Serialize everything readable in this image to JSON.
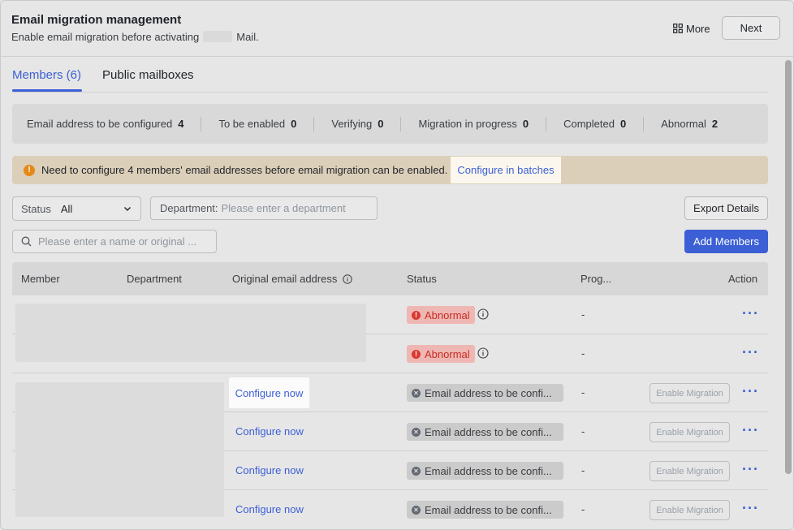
{
  "header": {
    "title": "Email migration management",
    "subtitle_prefix": "Enable email migration before activating",
    "subtitle_suffix": "Mail.",
    "more_label": "More",
    "next_label": "Next"
  },
  "tabs": [
    {
      "label": "Members (6)",
      "active": true
    },
    {
      "label": "Public mailboxes",
      "active": false
    }
  ],
  "stats": [
    {
      "label": "Email address to be configured",
      "value": "4"
    },
    {
      "label": "To be enabled",
      "value": "0"
    },
    {
      "label": "Verifying",
      "value": "0"
    },
    {
      "label": "Migration in progress",
      "value": "0"
    },
    {
      "label": "Completed",
      "value": "0"
    },
    {
      "label": "Abnormal",
      "value": "2"
    }
  ],
  "alert": {
    "text": "Need to configure 4 members' email addresses before email migration can be enabled.",
    "link": "Configure in batches"
  },
  "filters": {
    "status_label": "Status",
    "status_value": "All",
    "department_label": "Department:",
    "department_placeholder": "Please enter a department",
    "search_placeholder": "Please enter a name or original ...",
    "export_label": "Export Details",
    "add_label": "Add Members"
  },
  "table": {
    "columns": [
      "Member",
      "Department",
      "Original email address",
      "Status",
      "Prog...",
      "Action"
    ],
    "rows": [
      {
        "status": "Abnormal",
        "progress": "-",
        "configure": "",
        "enable": ""
      },
      {
        "status": "Abnormal",
        "progress": "-",
        "configure": "",
        "enable": ""
      },
      {
        "status": "Email address to be confi...",
        "progress": "-",
        "configure": "Configure now",
        "enable": "Enable Migration"
      },
      {
        "status": "Email address to be confi...",
        "progress": "-",
        "configure": "Configure now",
        "enable": "Enable Migration"
      },
      {
        "status": "Email address to be confi...",
        "progress": "-",
        "configure": "Configure now",
        "enable": "Enable Migration"
      },
      {
        "status": "Email address to be confi...",
        "progress": "-",
        "configure": "Configure now",
        "enable": "Enable Migration"
      }
    ],
    "more_glyph": "···"
  },
  "colors": {
    "accent": "#3c5fd6",
    "abnormal": "#c62d23",
    "warning": "#e58a17"
  }
}
